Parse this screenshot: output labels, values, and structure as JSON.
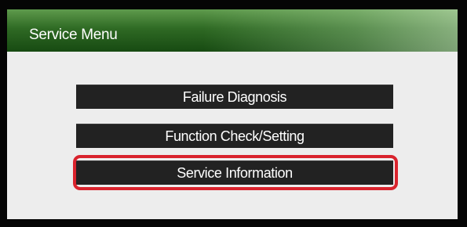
{
  "screen": {
    "title": "Service Menu"
  },
  "menu": {
    "items": [
      {
        "label": "Failure Diagnosis"
      },
      {
        "label": "Function Check/Setting"
      },
      {
        "label": "Service Information"
      }
    ],
    "highlighted_index": 2
  },
  "colors": {
    "titlebar": "#2f6a24",
    "panel": "#ededed",
    "button": "#222222",
    "button_text": "#ffffff",
    "highlight": "#d9232d"
  }
}
